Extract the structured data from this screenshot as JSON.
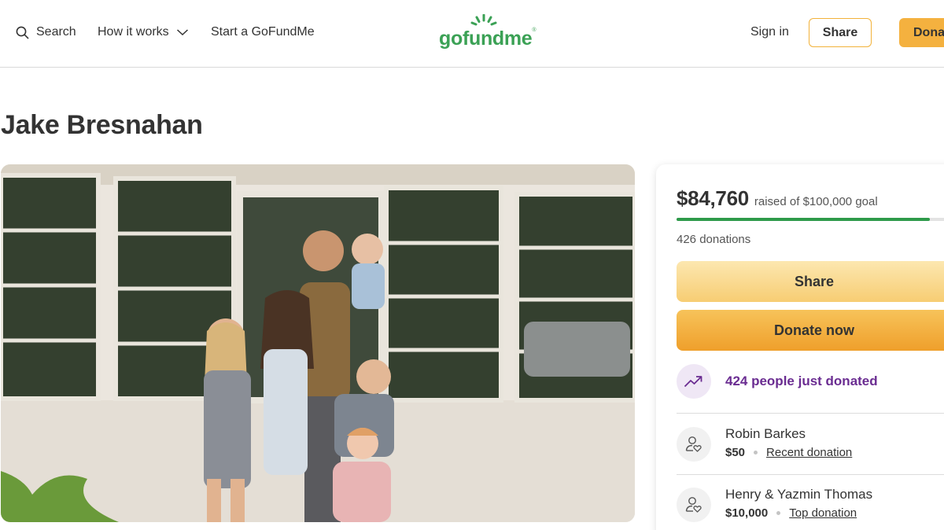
{
  "header": {
    "search_label": "Search",
    "how_it_works_label": "How it works",
    "start_label": "Start a GoFundMe",
    "logo_text": "gofundme",
    "signin_label": "Sign in",
    "share_label": "Share",
    "donate_label": "Donate"
  },
  "campaign": {
    "title": "Jake Bresnahan",
    "photo_icon": "family-photo"
  },
  "card": {
    "amount_raised": "$84,760",
    "goal_text": "raised of $100,000 goal",
    "progress_fraction": 0.8476,
    "donation_count": "426 donations",
    "share_label": "Share",
    "donate_label": "Donate now",
    "recent_activity": "424 people just donated",
    "donors": [
      {
        "name": "Robin Barkes",
        "amount": "$50",
        "tag": "Recent donation"
      },
      {
        "name": "Henry & Yazmin Thomas",
        "amount": "$10,000",
        "tag": "Top donation"
      }
    ]
  },
  "colors": {
    "brand_green": "#3ba155",
    "accent_yellow": "#f4b13f",
    "progress_green": "#2e9a4a",
    "activity_purple": "#6a2c91"
  }
}
